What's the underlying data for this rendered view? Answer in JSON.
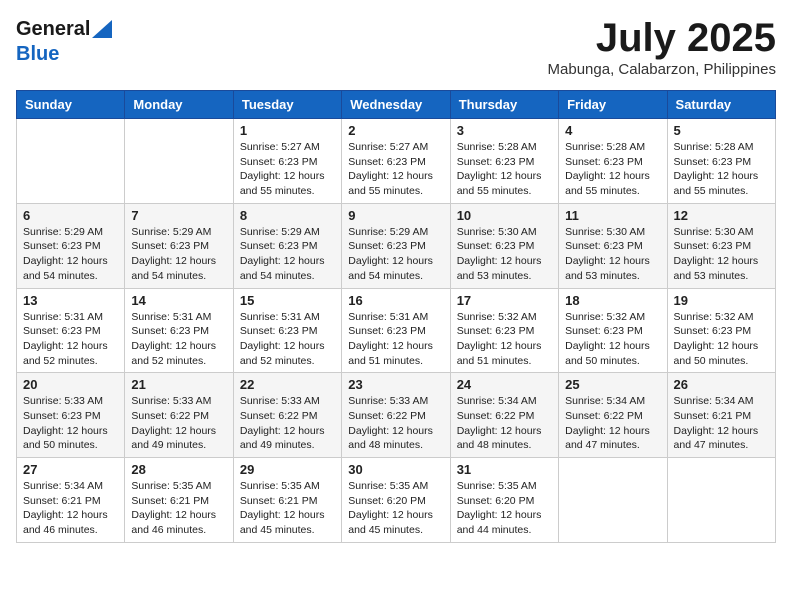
{
  "header": {
    "logo_general": "General",
    "logo_blue": "Blue",
    "month": "July 2025",
    "location": "Mabunga, Calabarzon, Philippines"
  },
  "weekdays": [
    "Sunday",
    "Monday",
    "Tuesday",
    "Wednesday",
    "Thursday",
    "Friday",
    "Saturday"
  ],
  "weeks": [
    [
      {
        "day": "",
        "info": ""
      },
      {
        "day": "",
        "info": ""
      },
      {
        "day": "1",
        "info": "Sunrise: 5:27 AM\nSunset: 6:23 PM\nDaylight: 12 hours\nand 55 minutes."
      },
      {
        "day": "2",
        "info": "Sunrise: 5:27 AM\nSunset: 6:23 PM\nDaylight: 12 hours\nand 55 minutes."
      },
      {
        "day": "3",
        "info": "Sunrise: 5:28 AM\nSunset: 6:23 PM\nDaylight: 12 hours\nand 55 minutes."
      },
      {
        "day": "4",
        "info": "Sunrise: 5:28 AM\nSunset: 6:23 PM\nDaylight: 12 hours\nand 55 minutes."
      },
      {
        "day": "5",
        "info": "Sunrise: 5:28 AM\nSunset: 6:23 PM\nDaylight: 12 hours\nand 55 minutes."
      }
    ],
    [
      {
        "day": "6",
        "info": "Sunrise: 5:29 AM\nSunset: 6:23 PM\nDaylight: 12 hours\nand 54 minutes."
      },
      {
        "day": "7",
        "info": "Sunrise: 5:29 AM\nSunset: 6:23 PM\nDaylight: 12 hours\nand 54 minutes."
      },
      {
        "day": "8",
        "info": "Sunrise: 5:29 AM\nSunset: 6:23 PM\nDaylight: 12 hours\nand 54 minutes."
      },
      {
        "day": "9",
        "info": "Sunrise: 5:29 AM\nSunset: 6:23 PM\nDaylight: 12 hours\nand 54 minutes."
      },
      {
        "day": "10",
        "info": "Sunrise: 5:30 AM\nSunset: 6:23 PM\nDaylight: 12 hours\nand 53 minutes."
      },
      {
        "day": "11",
        "info": "Sunrise: 5:30 AM\nSunset: 6:23 PM\nDaylight: 12 hours\nand 53 minutes."
      },
      {
        "day": "12",
        "info": "Sunrise: 5:30 AM\nSunset: 6:23 PM\nDaylight: 12 hours\nand 53 minutes."
      }
    ],
    [
      {
        "day": "13",
        "info": "Sunrise: 5:31 AM\nSunset: 6:23 PM\nDaylight: 12 hours\nand 52 minutes."
      },
      {
        "day": "14",
        "info": "Sunrise: 5:31 AM\nSunset: 6:23 PM\nDaylight: 12 hours\nand 52 minutes."
      },
      {
        "day": "15",
        "info": "Sunrise: 5:31 AM\nSunset: 6:23 PM\nDaylight: 12 hours\nand 52 minutes."
      },
      {
        "day": "16",
        "info": "Sunrise: 5:31 AM\nSunset: 6:23 PM\nDaylight: 12 hours\nand 51 minutes."
      },
      {
        "day": "17",
        "info": "Sunrise: 5:32 AM\nSunset: 6:23 PM\nDaylight: 12 hours\nand 51 minutes."
      },
      {
        "day": "18",
        "info": "Sunrise: 5:32 AM\nSunset: 6:23 PM\nDaylight: 12 hours\nand 50 minutes."
      },
      {
        "day": "19",
        "info": "Sunrise: 5:32 AM\nSunset: 6:23 PM\nDaylight: 12 hours\nand 50 minutes."
      }
    ],
    [
      {
        "day": "20",
        "info": "Sunrise: 5:33 AM\nSunset: 6:23 PM\nDaylight: 12 hours\nand 50 minutes."
      },
      {
        "day": "21",
        "info": "Sunrise: 5:33 AM\nSunset: 6:22 PM\nDaylight: 12 hours\nand 49 minutes."
      },
      {
        "day": "22",
        "info": "Sunrise: 5:33 AM\nSunset: 6:22 PM\nDaylight: 12 hours\nand 49 minutes."
      },
      {
        "day": "23",
        "info": "Sunrise: 5:33 AM\nSunset: 6:22 PM\nDaylight: 12 hours\nand 48 minutes."
      },
      {
        "day": "24",
        "info": "Sunrise: 5:34 AM\nSunset: 6:22 PM\nDaylight: 12 hours\nand 48 minutes."
      },
      {
        "day": "25",
        "info": "Sunrise: 5:34 AM\nSunset: 6:22 PM\nDaylight: 12 hours\nand 47 minutes."
      },
      {
        "day": "26",
        "info": "Sunrise: 5:34 AM\nSunset: 6:21 PM\nDaylight: 12 hours\nand 47 minutes."
      }
    ],
    [
      {
        "day": "27",
        "info": "Sunrise: 5:34 AM\nSunset: 6:21 PM\nDaylight: 12 hours\nand 46 minutes."
      },
      {
        "day": "28",
        "info": "Sunrise: 5:35 AM\nSunset: 6:21 PM\nDaylight: 12 hours\nand 46 minutes."
      },
      {
        "day": "29",
        "info": "Sunrise: 5:35 AM\nSunset: 6:21 PM\nDaylight: 12 hours\nand 45 minutes."
      },
      {
        "day": "30",
        "info": "Sunrise: 5:35 AM\nSunset: 6:20 PM\nDaylight: 12 hours\nand 45 minutes."
      },
      {
        "day": "31",
        "info": "Sunrise: 5:35 AM\nSunset: 6:20 PM\nDaylight: 12 hours\nand 44 minutes."
      },
      {
        "day": "",
        "info": ""
      },
      {
        "day": "",
        "info": ""
      }
    ]
  ]
}
